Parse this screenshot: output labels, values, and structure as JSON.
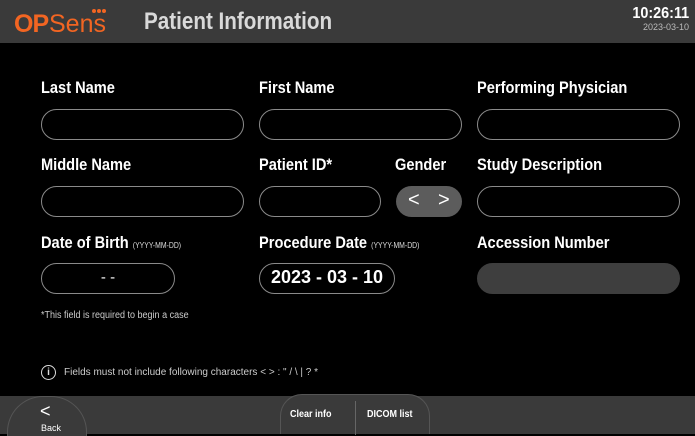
{
  "header": {
    "logo_op": "OP",
    "logo_sens": "Sens",
    "title": "Patient Information",
    "time": "10:26:11",
    "date": "2023-03-10"
  },
  "fields": {
    "last_name": {
      "label": "Last Name",
      "value": ""
    },
    "first_name": {
      "label": "First Name",
      "value": ""
    },
    "performing_physician": {
      "label": "Performing Physician",
      "value": ""
    },
    "middle_name": {
      "label": "Middle Name",
      "value": ""
    },
    "patient_id": {
      "label": "Patient ID*",
      "value": ""
    },
    "gender": {
      "label": "Gender",
      "prev": "<",
      "next": ">"
    },
    "study_description": {
      "label": "Study Description",
      "value": ""
    },
    "date_of_birth": {
      "label": "Date of Birth",
      "format": "(YYYY-MM-DD)",
      "value": "-   -"
    },
    "procedure_date": {
      "label": "Procedure Date",
      "format": "(YYYY-MM-DD)",
      "value": "2023 - 03 - 10"
    },
    "accession_number": {
      "label": "Accession Number",
      "value": ""
    }
  },
  "required_note": "*This field is required to begin a case",
  "warning": "Fields must not include following characters < > : \" / \\ | ? *",
  "footer": {
    "back_label": "Back",
    "clear_info": "Clear info",
    "dicom_list": "DICOM list"
  }
}
